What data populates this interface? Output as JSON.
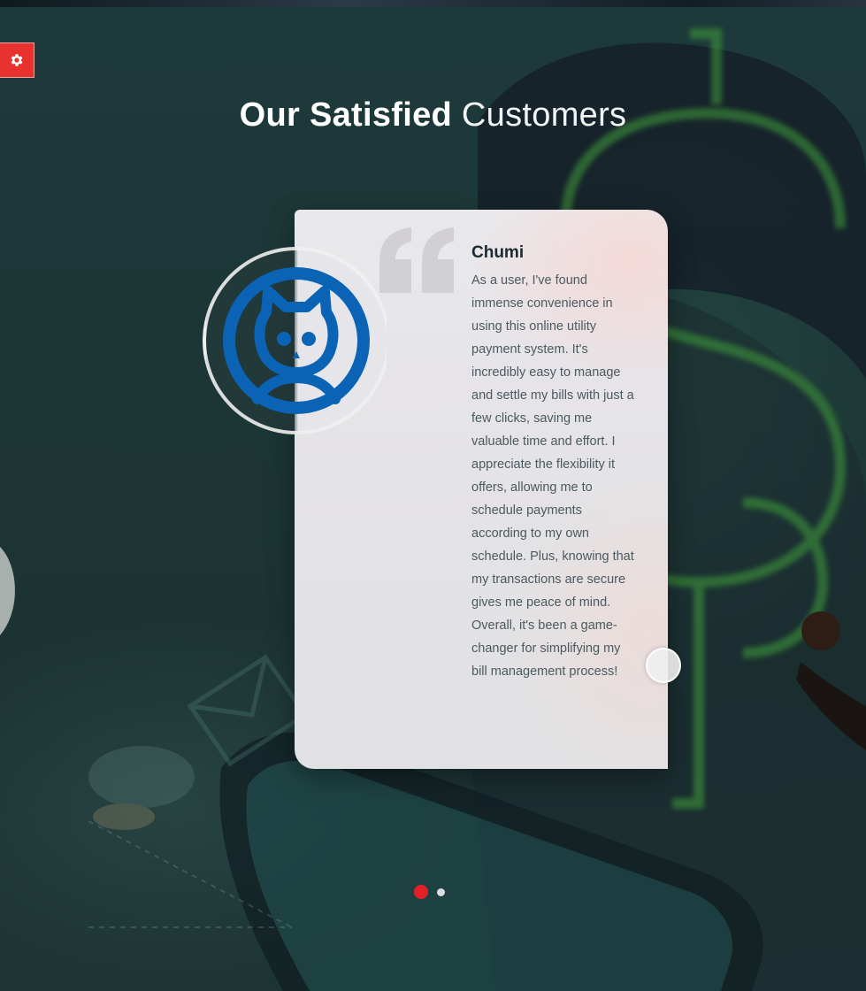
{
  "section": {
    "title_bold": "Our Satisfied",
    "title_light": "Customers"
  },
  "testimonial": {
    "name": "Chumi",
    "text": "As a user, I've found immense convenience in using this online utility payment system. It's incredibly easy to manage and settle my bills with just a few clicks, saving me valuable time and effort. I appreciate the flexibility it offers, allowing me to schedule payments according to my own schedule. Plus, knowing that my transactions are secure gives me peace of mind. Overall, it's been a game-changer for simplifying my bill management process!",
    "avatar_icon": "cat-avatar-icon",
    "quote_icon": "quote-icon"
  },
  "carousel": {
    "total_slides": 2,
    "active_slide": 1
  },
  "settings": {
    "icon": "gear-icon"
  },
  "colors": {
    "accent": "#e3202a",
    "avatar_blue": "#0a63b5",
    "settings_red": "#e8322d"
  }
}
